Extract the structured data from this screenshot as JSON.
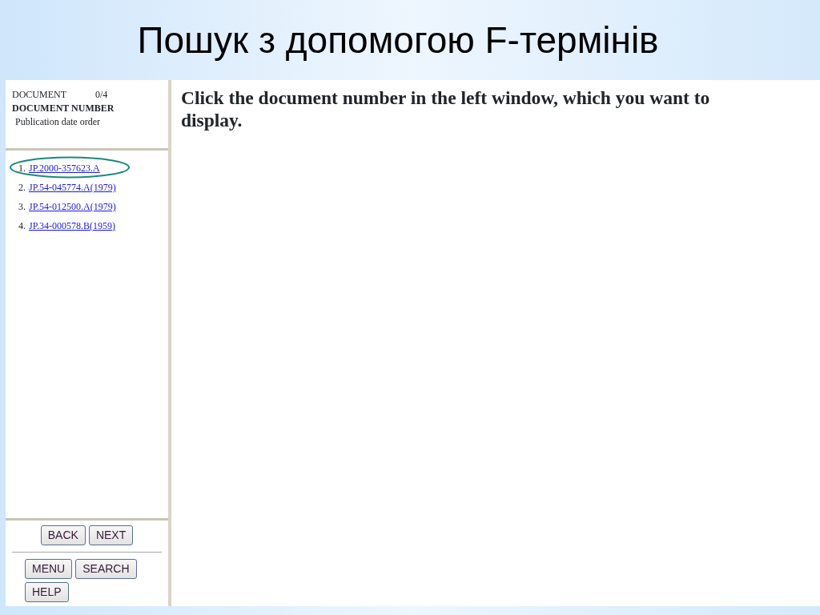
{
  "slide_title": "Пошук з допомогою F-термінів",
  "header": {
    "label": "DOCUMENT",
    "count": "0/4",
    "subtitle": "DOCUMENT NUMBER",
    "order": "Publication date order"
  },
  "documents": [
    {
      "number": "1.",
      "link": "JP.2000-357623.A",
      "highlighted": true
    },
    {
      "number": "2.",
      "link": "JP.54-045774.A(1979)",
      "highlighted": false
    },
    {
      "number": "3.",
      "link": "JP.54-012500.A(1979)",
      "highlighted": false
    },
    {
      "number": "4.",
      "link": "JP.34-000578.B(1959)",
      "highlighted": false
    }
  ],
  "nav_buttons": [
    "BACK",
    "NEXT"
  ],
  "menu_buttons": [
    "MENU",
    "SEARCH",
    "HELP"
  ],
  "message": "Click the document number in the left window, which you want to display."
}
